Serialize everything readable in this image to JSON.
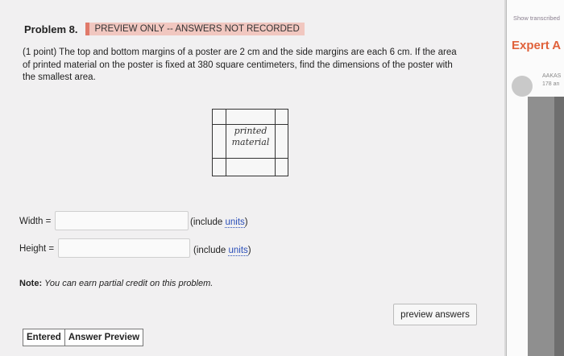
{
  "problem": {
    "title": "Problem 8.",
    "badge": "PREVIEW ONLY -- ANSWERS NOT RECORDED",
    "statement_line1": "(1 point) The top and bottom margins of a poster are 2 cm and the side margins are each 6 cm. If the area",
    "statement_line2": "of printed material on the poster is fixed at 380 square centimeters, find the dimensions of the poster with",
    "statement_line3": "the smallest area.",
    "figure_label_1": "printed",
    "figure_label_2": "material"
  },
  "answers": {
    "width_label": "Width =",
    "height_label": "Height =",
    "include_prefix": "(include ",
    "units_link": "units",
    "include_suffix": ")"
  },
  "note": {
    "bold": "Note:",
    "italic": "You can earn partial credit on this problem."
  },
  "buttons": {
    "preview": "preview answers"
  },
  "tabs": [
    "Entered",
    "Answer Preview"
  ],
  "sidebar": {
    "show_transcribed": "Show transcribed",
    "expert": "Expert A",
    "name": "AAKAS",
    "sub": "178 an"
  }
}
